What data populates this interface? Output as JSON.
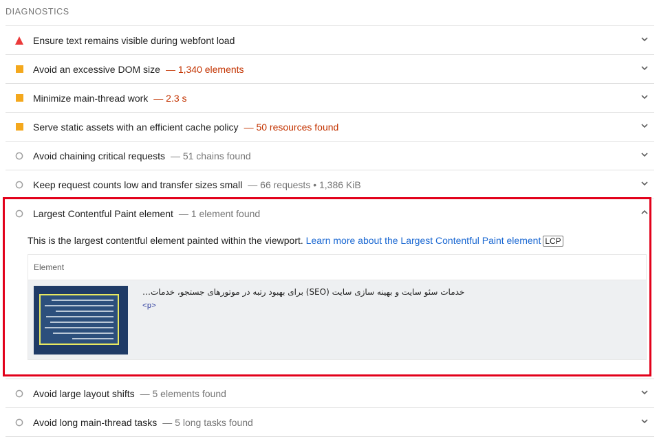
{
  "section_title": "DIAGNOSTICS",
  "audits_top": [
    {
      "icon": "fail",
      "title": "Ensure text remains visible during webfont load",
      "display": ""
    },
    {
      "icon": "average",
      "title": "Avoid an excessive DOM size",
      "display": "— 1,340 elements"
    },
    {
      "icon": "average",
      "title": "Minimize main-thread work",
      "display": "— 2.3 s"
    },
    {
      "icon": "average",
      "title": "Serve static assets with an efficient cache policy",
      "display": "— 50 resources found"
    },
    {
      "icon": "info",
      "title": "Avoid chaining critical requests",
      "display": "— 51 chains found"
    },
    {
      "icon": "info",
      "title": "Keep request counts low and transfer sizes small",
      "display": "— 66 requests • 1,386 KiB"
    }
  ],
  "expanded_audit": {
    "icon": "info",
    "title": "Largest Contentful Paint element",
    "display": "— 1 element found",
    "description": "This is the largest contentful element painted within the viewport.",
    "learn_more": "Learn more about the Largest Contentful Paint element",
    "badge": "LCP",
    "table_header": "Element",
    "snippet": "خدمات سئو سایت و بهینه سازی سایت (SEO) برای بهبود رتبه در موتورهای جستجو، خدمات…",
    "tag": "<p>"
  },
  "audits_bottom": [
    {
      "icon": "info",
      "title": "Avoid large layout shifts",
      "display": "— 5 elements found"
    },
    {
      "icon": "info",
      "title": "Avoid long main-thread tasks",
      "display": "— 5 long tasks found"
    }
  ],
  "colors": {
    "fail": "#eb3a3a",
    "average": "#f4a81d",
    "info": "#9e9e9e",
    "warn_text": "#c33300",
    "highlight": "#e2001a"
  }
}
